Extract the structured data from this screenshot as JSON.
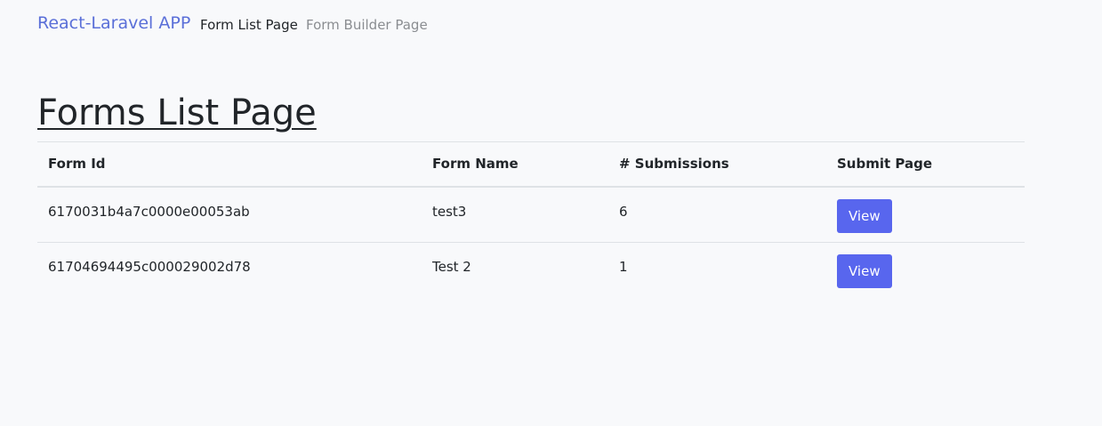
{
  "navbar": {
    "brand": "React-Laravel APP",
    "links": [
      {
        "label": "Form List Page",
        "active": true
      },
      {
        "label": "Form Builder Page",
        "active": false
      }
    ]
  },
  "page": {
    "title": "Forms List Page"
  },
  "table": {
    "headers": [
      "Form Id",
      "Form Name",
      "# Submissions",
      "Submit Page"
    ],
    "rows": [
      {
        "form_id": "6170031b4a7c0000e00053ab",
        "form_name": "test3",
        "submissions": "6",
        "action_label": "View"
      },
      {
        "form_id": "61704694495c000029002d78",
        "form_name": "Test 2",
        "submissions": "1",
        "action_label": "View"
      }
    ]
  },
  "colors": {
    "brand": "#5a6fd8",
    "button": "#5866ee",
    "background": "#f8f9fb"
  }
}
